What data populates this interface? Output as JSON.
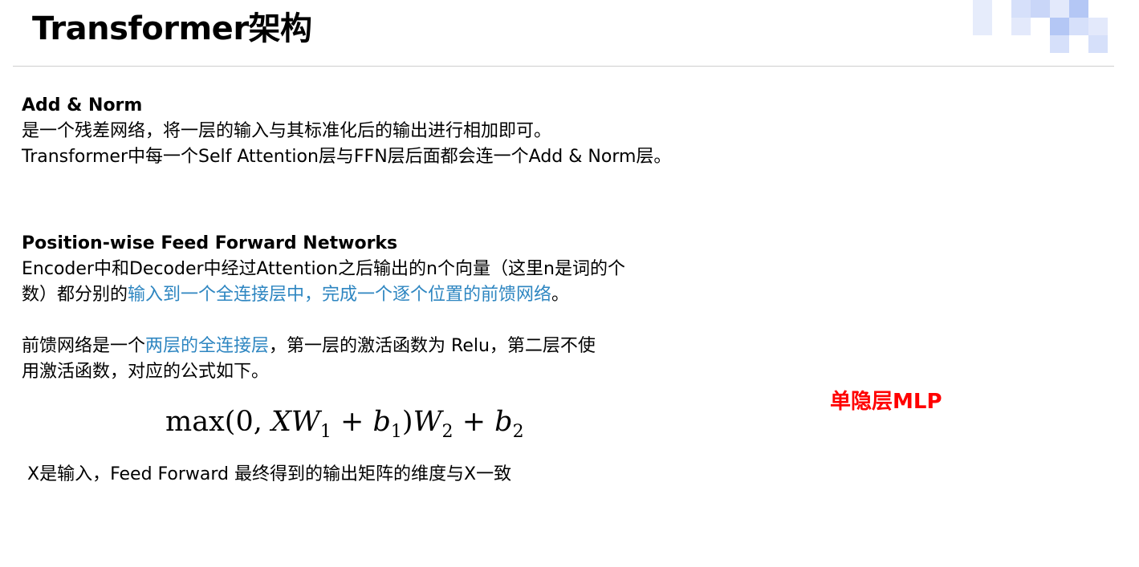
{
  "slide": {
    "title": "Transformer架构"
  },
  "add_norm": {
    "heading": "Add & Norm",
    "line1": "是一个残差网络，将一层的输入与其标准化后的输出进行相加即可。",
    "line2": "Transformer中每一个Self Attention层与FFN层后面都会连一个Add & Norm层。"
  },
  "ffn": {
    "heading": "Position-wise Feed Forward Networks",
    "para1_line1": "Encoder中和Decoder中经过Attention之后输出的n个向量（这里n是词的个",
    "para1_line2_plain": "数）都分别的",
    "para1_line2_accent": "输入到一个全连接层中，完成一个逐个位置的前馈网络",
    "para1_line2_end": "。",
    "para2_line1_plain": "前馈网络是一个",
    "para2_line1_accent": "两层的全连接层",
    "para2_line1_end": "，第一层的激活函数为 Relu，第二层不使",
    "para2_line2": "用激活函数，对应的公式如下。"
  },
  "formula": {
    "part1": "max(0,",
    "x": "X",
    "w": "W",
    "sub1": "1",
    "plus1": "+",
    "b": "b",
    "sub_b1": "1",
    "close": ")",
    "w2": "W",
    "sub2": "2",
    "plus2": "+",
    "b2": "b",
    "sub_b2": "2"
  },
  "note": {
    "text": "X是输入，Feed Forward 最终得到的输出矩阵的维度与X一致"
  },
  "callout": {
    "text": "单隐层MLP",
    "color": "#ff0000"
  },
  "colors": {
    "accent": "#2e86c1",
    "deco_light": "#e3e9fb",
    "deco_mid": "#c9d6f8",
    "deco_dark": "#b4c7f5"
  }
}
